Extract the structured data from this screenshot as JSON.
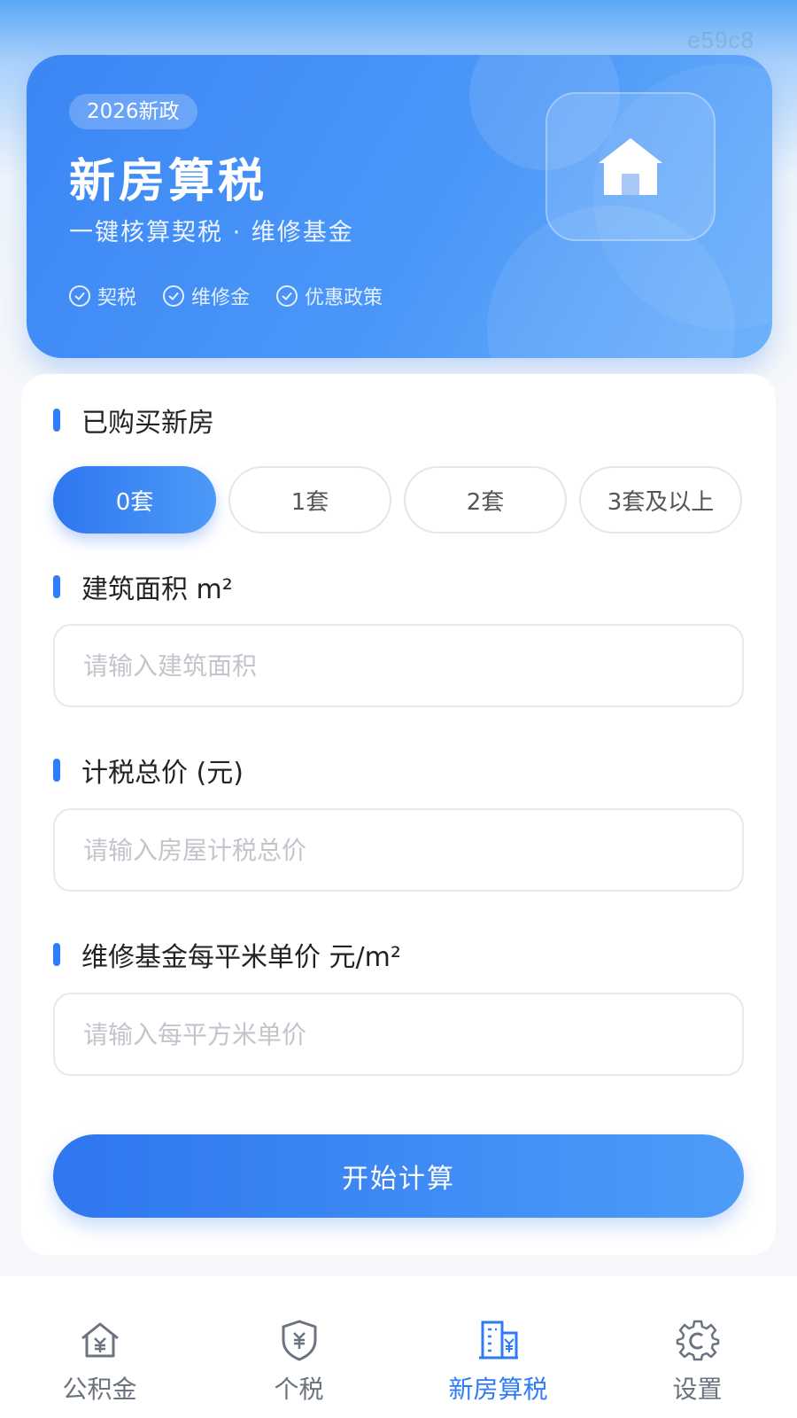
{
  "watermark": "e59c8",
  "hero": {
    "badge": "2026新政",
    "title": "新房算税",
    "subtitle": "一键核算契税 · 维修基金",
    "tags": [
      "契税",
      "维修金",
      "优惠政策"
    ],
    "icon": "house-icon"
  },
  "form": {
    "owned_label": "已购买新房",
    "owned_options": [
      "0套",
      "1套",
      "2套",
      "3套及以上"
    ],
    "owned_selected": "0套",
    "area_label": "建筑面积 m²",
    "area_placeholder": "请输入建筑面积",
    "area_value": "",
    "price_label": "计税总价 (元)",
    "price_placeholder": "请输入房屋计税总价",
    "price_value": "",
    "fund_label": "维修基金每平米单价 元/m²",
    "fund_placeholder": "请输入每平方米单价",
    "fund_value": "",
    "submit_label": "开始计算"
  },
  "tabbar": {
    "items": [
      {
        "label": "公积金",
        "icon": "house-yuan-icon",
        "active": false
      },
      {
        "label": "个税",
        "icon": "shield-yuan-icon",
        "active": false
      },
      {
        "label": "新房算税",
        "icon": "building-yuan-icon",
        "active": true
      },
      {
        "label": "设置",
        "icon": "gear-icon",
        "active": false
      }
    ]
  },
  "colors": {
    "accent": "#2f7cf6",
    "hero_start": "#3c86f5",
    "hero_end": "#6db2fb",
    "inactive_tab": "#6b7380"
  }
}
